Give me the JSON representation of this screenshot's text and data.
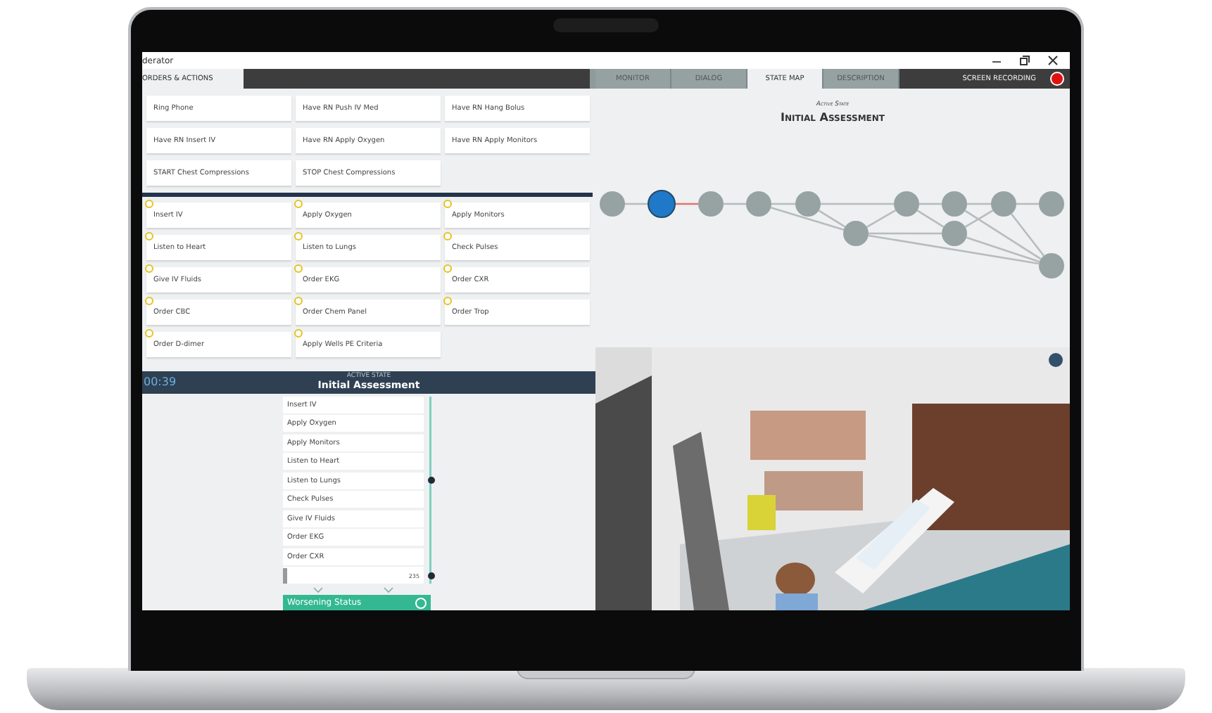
{
  "window": {
    "title": "derator"
  },
  "order_tabs": [
    {
      "label": "ORDERS & ACTIONS",
      "selected": true
    }
  ],
  "view_tabs": [
    {
      "label": "MONITOR",
      "selected": false
    },
    {
      "label": "DIALOG",
      "selected": false
    },
    {
      "label": "STATE MAP",
      "selected": true
    },
    {
      "label": "DESCRIPTION",
      "selected": false
    }
  ],
  "recording": {
    "label": "SCREEN RECORDING"
  },
  "rn_actions": [
    "Ring Phone",
    "Have RN Push IV Med",
    "Have RN Hang Bolus",
    "Have RN Insert IV",
    "Have RN Apply Oxygen",
    "Have RN Apply Monitors",
    "START Chest Compressions",
    "STOP Chest Compressions"
  ],
  "tasks": [
    {
      "label": "Insert IV",
      "marked": true
    },
    {
      "label": "Apply Oxygen",
      "marked": true
    },
    {
      "label": "Apply Monitors",
      "marked": true
    },
    {
      "label": "Listen to Heart",
      "marked": true
    },
    {
      "label": "Listen to Lungs",
      "marked": true
    },
    {
      "label": "Check Pulses",
      "marked": true
    },
    {
      "label": "Give IV Fluids",
      "marked": true
    },
    {
      "label": "Order EKG",
      "marked": true
    },
    {
      "label": "Order CXR",
      "marked": true
    },
    {
      "label": "Order CBC",
      "marked": true
    },
    {
      "label": "Order Chem Panel",
      "marked": true
    },
    {
      "label": "Order Trop",
      "marked": true
    },
    {
      "label": "Order D-dimer",
      "marked": true
    },
    {
      "label": "Apply Wells PE Criteria",
      "marked": true
    }
  ],
  "timeline": {
    "timer": "00:39",
    "caption": "ACTIVE STATE",
    "state": "Initial Assessment",
    "items": [
      "Insert IV",
      "Apply Oxygen",
      "Apply Monitors",
      "Listen to Heart",
      "Listen to Lungs",
      "Check Pulses",
      "Give IV Fluids",
      "Order EKG",
      "Order CXR"
    ],
    "entry_value": "235",
    "action": "Worsening Status"
  },
  "state_map": {
    "caption": "Active State",
    "title": "Initial Assessment",
    "nodes": [
      {
        "selected": false
      },
      {
        "selected": true
      },
      {
        "selected": false
      },
      {
        "selected": false
      },
      {
        "selected": false
      },
      {
        "selected": false
      },
      {
        "selected": false
      },
      {
        "selected": false
      },
      {
        "selected": false
      },
      {
        "selected": false
      },
      {
        "selected": false
      },
      {
        "selected": false
      }
    ]
  }
}
